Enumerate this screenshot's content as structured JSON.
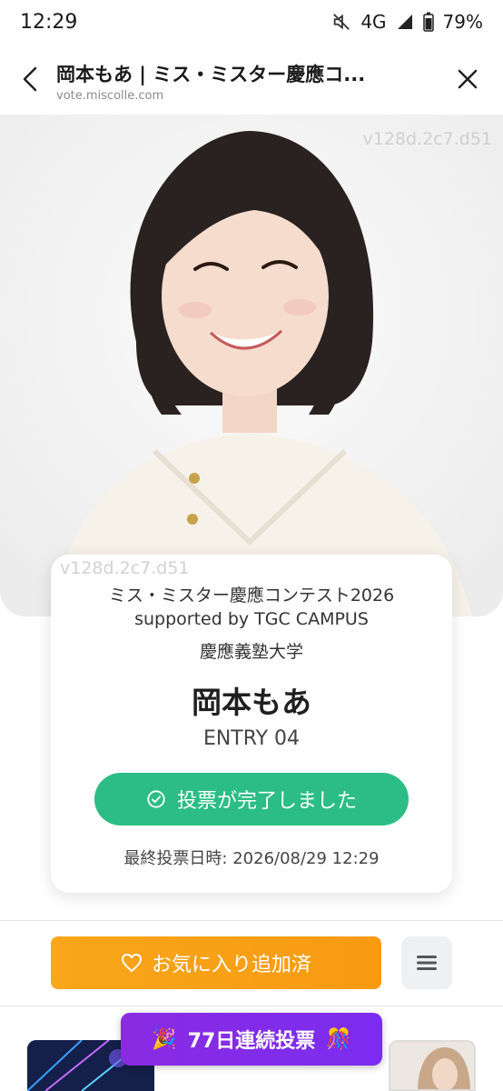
{
  "status_bar": {
    "time": "12:29",
    "network": "4G",
    "battery": "79%",
    "icons": [
      "mute-icon",
      "signal-icon",
      "battery-icon"
    ]
  },
  "browser": {
    "title": "岡本もあ | ミス・ミスター慶應コ...",
    "url": "vote.miscolle.com",
    "icons": [
      "back-arrow-icon",
      "close-icon"
    ]
  },
  "hero": {
    "watermark_top": "v128d.2c7.d51",
    "watermark_card": "v128d.2c7.d51"
  },
  "profile": {
    "contest_name": "ミス・ミスター慶應コンテスト2026",
    "contest_sub": "supported by TGC CAMPUS",
    "university": "慶應義塾大学",
    "name": "岡本もあ",
    "entry": "ENTRY 04",
    "vote_done_label": "投票が完了しました",
    "last_vote": "最終投票日時: 2026/08/29 12:29"
  },
  "actions": {
    "favorite_label": "お気に入り追加済",
    "menu_icon": "hamburger-icon"
  },
  "streak": {
    "label": "77日連続投票",
    "icon_left": "🎉",
    "icon_right": "🎊"
  },
  "colors": {
    "vote_green": "#2bbd85",
    "favorite_orange": "#f89a12",
    "streak_purple": "#7b2cf0"
  }
}
